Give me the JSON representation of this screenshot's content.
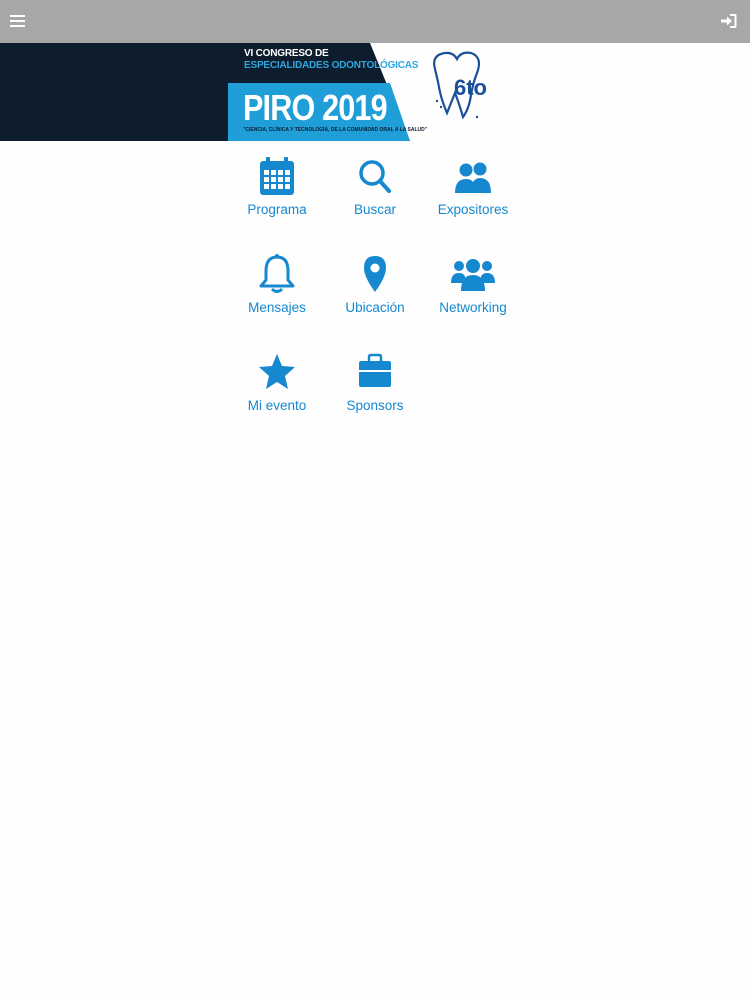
{
  "topbar": {
    "menu_icon": "hamburger-menu-icon",
    "login_icon": "sign-in-icon"
  },
  "banner": {
    "line1": "VI CONGRESO DE",
    "line2": "ESPECIALIDADES ODONTOLÓGICAS",
    "event_name": "PIRO 2019",
    "slogan": "\"CIENCIA, CLÍNICA Y TECNOLOGÍA, DE LA COMUNIDAD ORAL A LA SALUD\"",
    "logo_text": "6to",
    "colors": {
      "dark": "#0e1d2d",
      "blue": "#1f9ed8"
    }
  },
  "menu": {
    "accent_color": "#1688cf",
    "items": [
      {
        "label": "Programa",
        "icon": "calendar-icon"
      },
      {
        "label": "Buscar",
        "icon": "search-icon"
      },
      {
        "label": "Expositores",
        "icon": "users-icon"
      },
      {
        "label": "Mensajes",
        "icon": "bell-icon"
      },
      {
        "label": "Ubicación",
        "icon": "map-marker-icon"
      },
      {
        "label": "Networking",
        "icon": "group-icon"
      },
      {
        "label": "Mi evento",
        "icon": "star-icon"
      },
      {
        "label": "Sponsors",
        "icon": "briefcase-icon"
      }
    ]
  }
}
